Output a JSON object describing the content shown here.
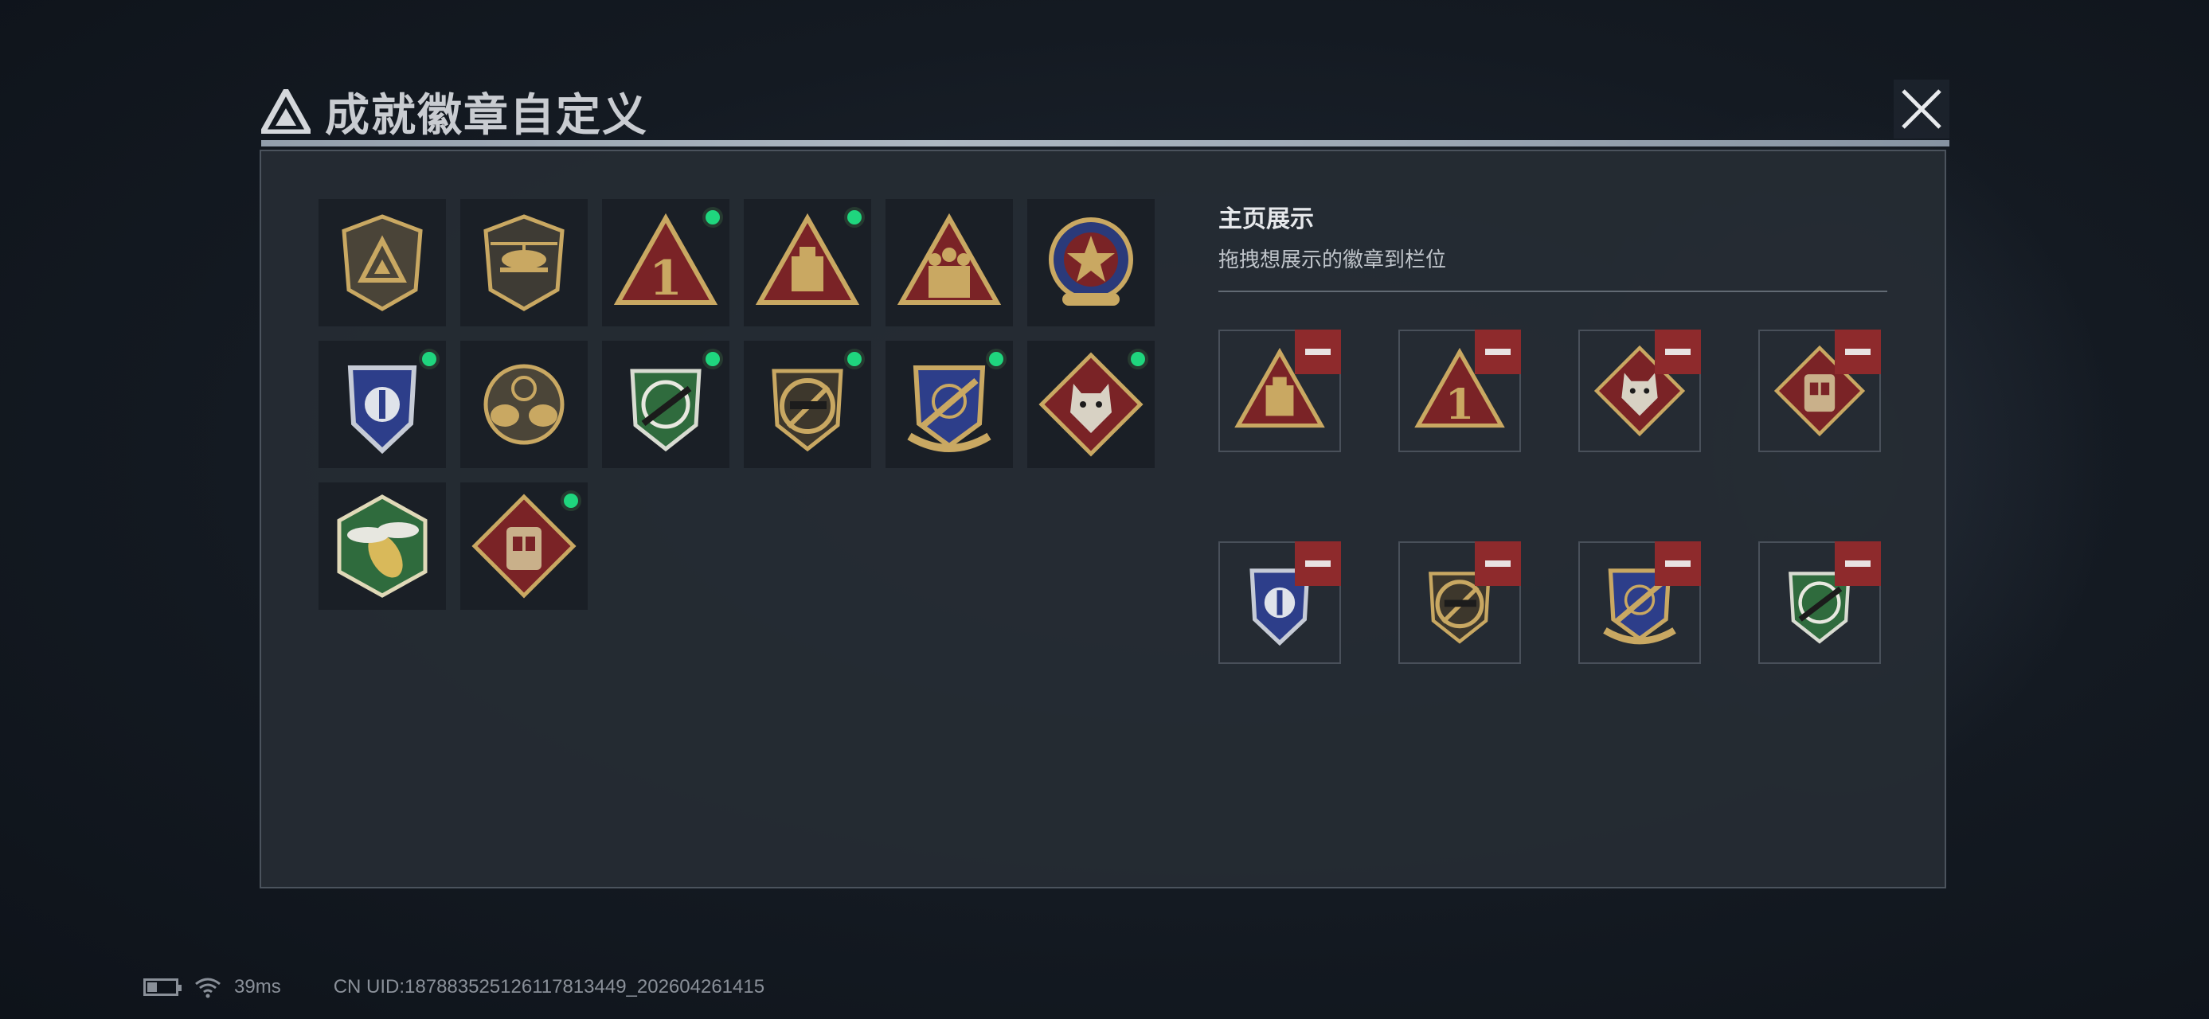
{
  "header": {
    "title": "成就徽章自定义",
    "close_icon": "close-icon",
    "logo_icon": "triangle-logo-icon"
  },
  "colors": {
    "new_dot": "#1fd67e",
    "remove_button": "#8e2a2c",
    "panel_bg": "#262c34"
  },
  "collection": [
    {
      "name": "shield-triangle-badge",
      "new": false
    },
    {
      "name": "helicopter-badge",
      "new": false
    },
    {
      "name": "number-one-triangle-badge",
      "new": true
    },
    {
      "name": "crate-triangle-badge",
      "new": true
    },
    {
      "name": "soldiers-triangle-badge",
      "new": false
    },
    {
      "name": "star-emblem-badge",
      "new": false
    },
    {
      "name": "blue-shield-badge",
      "new": true
    },
    {
      "name": "crosshair-skull-badge",
      "new": false
    },
    {
      "name": "green-rifle-crosshair-badge",
      "new": true
    },
    {
      "name": "rifle-no-sign-badge",
      "new": true
    },
    {
      "name": "gold-blue-crossed-rifles-badge",
      "new": true
    },
    {
      "name": "wolf-diamond-badge",
      "new": true
    },
    {
      "name": "hornet-hexagon-badge",
      "new": false
    },
    {
      "name": "vest-diamond-badge",
      "new": true
    }
  ],
  "showcase": {
    "title": "主页展示",
    "subtitle": "拖拽想展示的徽章到栏位",
    "slots": [
      "crate-triangle-badge",
      "number-one-triangle-badge",
      "wolf-diamond-badge",
      "vest-diamond-badge",
      "blue-shield-badge",
      "rifle-no-sign-badge",
      "gold-blue-crossed-rifles-badge",
      "green-rifle-crosshair-badge"
    ],
    "remove_icon": "minus-icon"
  },
  "status_bar": {
    "ping": "39ms",
    "uid": "CN UID:18788352512611781344‌9_202604261415"
  }
}
